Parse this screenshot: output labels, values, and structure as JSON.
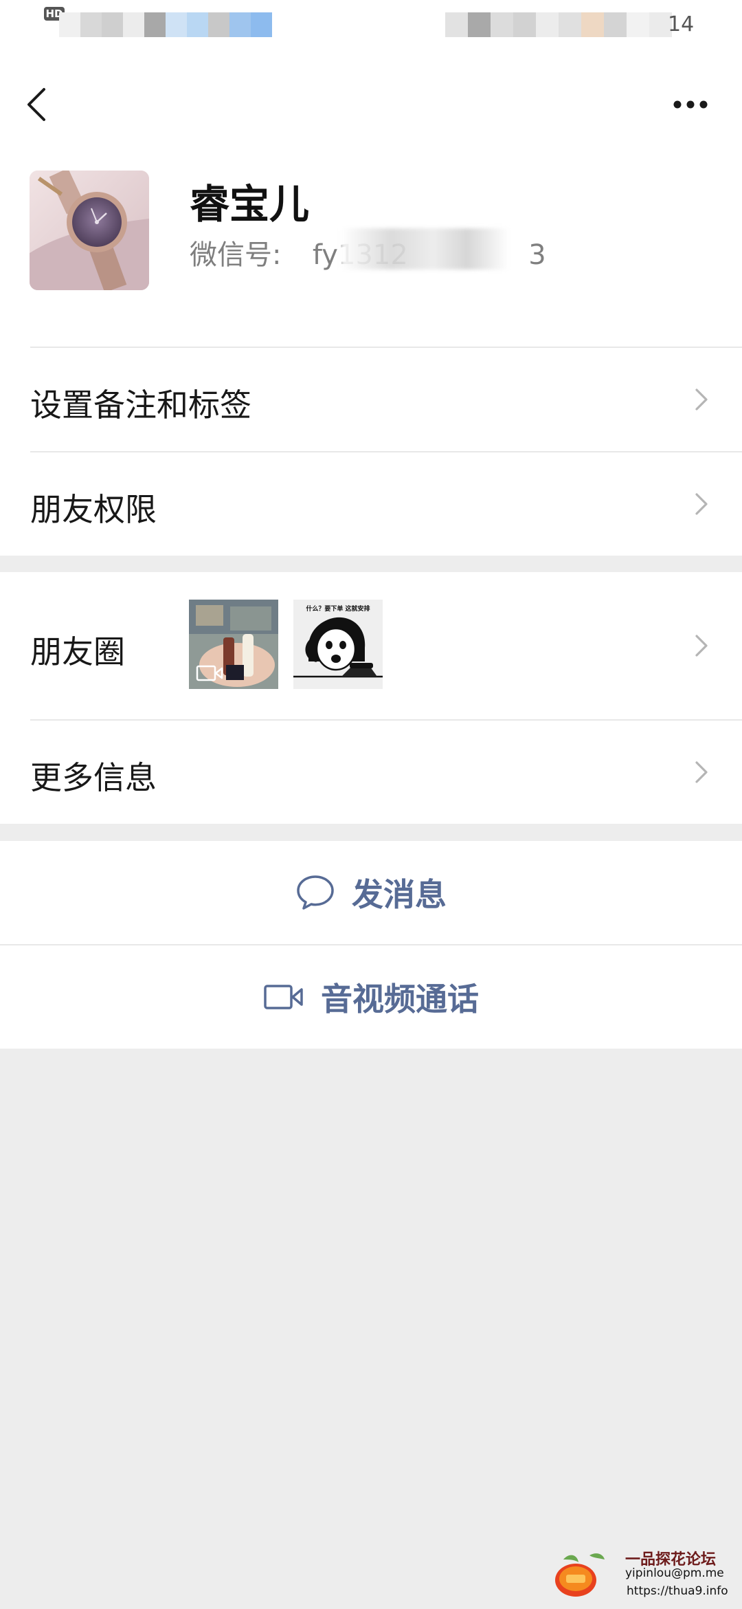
{
  "status_bar": {
    "hd_badge": "HD",
    "time_partial": "14"
  },
  "header": {
    "back_icon": "chevron-left-icon",
    "more_icon": "more-dots-icon"
  },
  "profile": {
    "name": "睿宝儿",
    "wechat_id_label": "微信号:",
    "wechat_id_visible": "fy1312",
    "wechat_id_tail": "3"
  },
  "settings": {
    "remark_tags": "设置备注和标签",
    "friend_permissions": "朋友权限"
  },
  "info": {
    "moments": "朋友圈",
    "moments_thumb2_caption": "什么？要下单 这就安排",
    "more_info": "更多信息"
  },
  "actions": {
    "send_message": "发消息",
    "send_message_icon": "chat-bubble-icon",
    "av_call": "音视频通话",
    "av_call_icon": "video-camera-icon"
  },
  "colors": {
    "link_blue": "#576b95",
    "background": "#ededed",
    "divider": "#e8e8e8"
  },
  "watermark": {
    "title": "一品探花论坛",
    "email": "yipinlou@pm.me",
    "url": "https://thua9.info"
  }
}
